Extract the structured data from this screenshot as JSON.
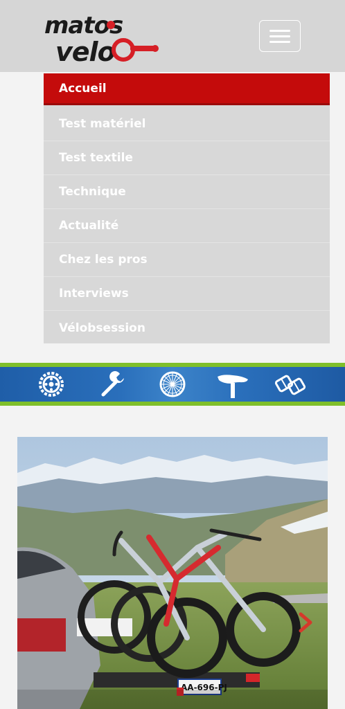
{
  "header": {
    "logo_alt": "Matos Vélo",
    "logo_line1": "matos",
    "logo_line2": "velo",
    "menu_button_label": "menu"
  },
  "nav": {
    "items": [
      {
        "label": "Accueil",
        "active": true
      },
      {
        "label": "Test matériel",
        "active": false
      },
      {
        "label": "Test textile",
        "active": false
      },
      {
        "label": "Technique",
        "active": false
      },
      {
        "label": "Actualité",
        "active": false
      },
      {
        "label": "Chez les pros",
        "active": false
      },
      {
        "label": "Interviews",
        "active": false
      },
      {
        "label": "Vélobsession",
        "active": false
      }
    ]
  },
  "category_band": {
    "icons": [
      "chainring-icon",
      "wrench-icon",
      "wheel-icon",
      "saddle-icon",
      "pedals-icon"
    ]
  },
  "hero": {
    "image_alt": "Bike rack with bicycles on a car in the mountains",
    "plate_text": "AA-696-PJ"
  },
  "colors": {
    "header_bg": "#d6d6d6",
    "active_red": "#c40b0b",
    "band_blue": "#2a6fbb",
    "band_green": "#7fbf2a"
  }
}
